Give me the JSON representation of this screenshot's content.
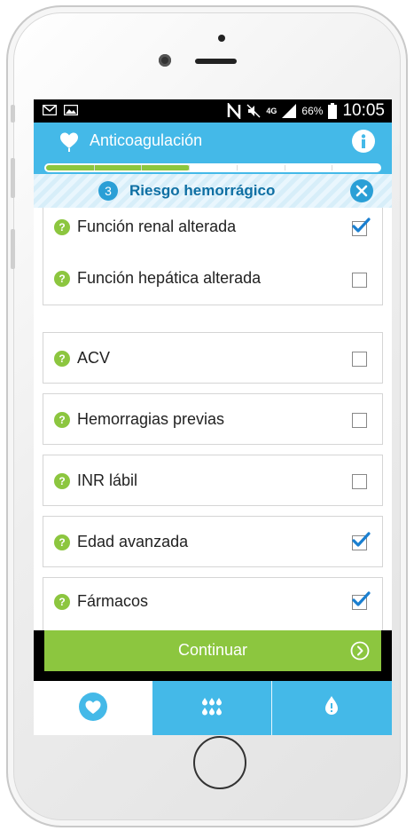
{
  "status_bar": {
    "time": "10:05",
    "battery_percent": "66%",
    "network": "4G",
    "icons": [
      "mail-icon",
      "image-icon",
      "nfc-icon",
      "mute-icon",
      "signal-icon",
      "battery-icon"
    ]
  },
  "header": {
    "title": "Anticoagulación",
    "icons": [
      "heart-icon",
      "info-icon"
    ]
  },
  "progress": {
    "value": 0.43,
    "segments": 7
  },
  "section": {
    "step": "3",
    "title": "Riesgo hemorrágico"
  },
  "items": [
    {
      "label": "Función renal alterada",
      "checked": true
    },
    {
      "label": "Función hepática alterada",
      "checked": false
    },
    {
      "label": "ACV",
      "checked": false
    },
    {
      "label": "Hemorragias previas",
      "checked": false
    },
    {
      "label": "INR lábil",
      "checked": false
    },
    {
      "label": "Edad avanzada",
      "checked": true
    },
    {
      "label": "Fármacos",
      "checked": true
    }
  ],
  "help_glyph": "?",
  "continue_button": {
    "label": "Continuar"
  },
  "tabs": [
    {
      "icon": "heart-icon",
      "active": true
    },
    {
      "icon": "drops-grid-icon",
      "active": false
    },
    {
      "icon": "blood-drop-icon",
      "active": false
    }
  ],
  "colors": {
    "primary_blue": "#44b9e8",
    "accent_green": "#8cc63f",
    "dark_blue": "#2a9fd6",
    "check_blue": "#1a7fd0"
  }
}
